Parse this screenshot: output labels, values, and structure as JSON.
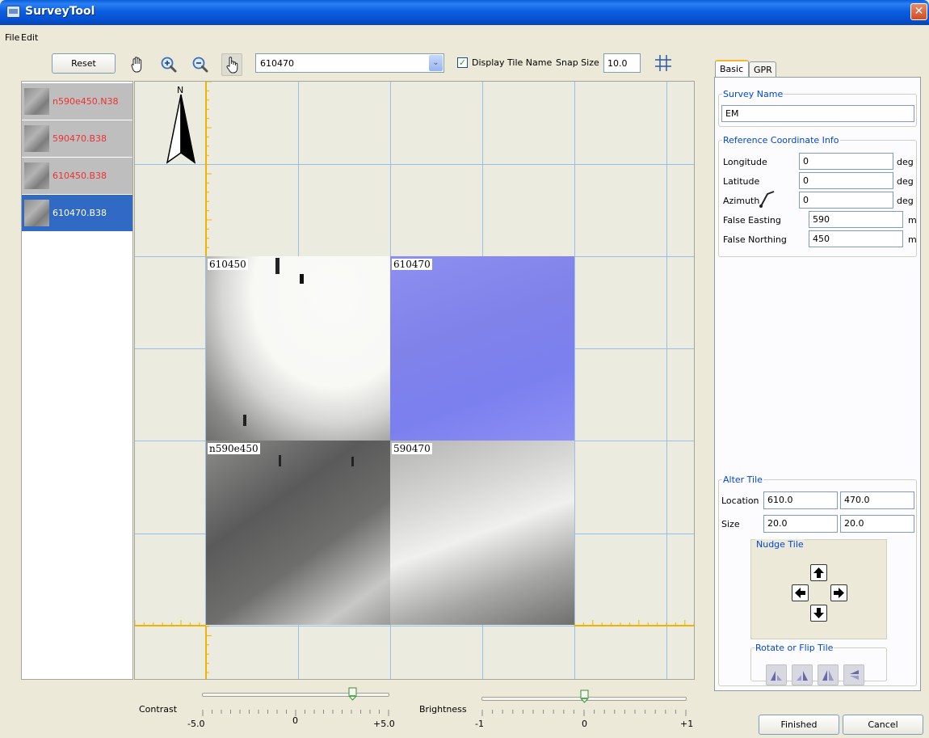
{
  "window": {
    "title": "SurveyTool",
    "close_label": "✕"
  },
  "menu": [
    "File",
    "Edit"
  ],
  "toolbar": {
    "reset_label": "Reset",
    "tile_select_value": "610470",
    "display_tile_name_checked": true,
    "display_tile_name_label": "Display Tile Name",
    "snap_size_label": "Snap Size",
    "snap_size_value": "10.0"
  },
  "files": [
    {
      "label": "n590e450.N38",
      "selected": false
    },
    {
      "label": "590470.B38",
      "selected": false
    },
    {
      "label": "610450.B38",
      "selected": false
    },
    {
      "label": "610470.B38",
      "selected": true
    }
  ],
  "canvas": {
    "north_label": "N",
    "tiles": [
      {
        "name": "610450",
        "highlighted": false
      },
      {
        "name": "610470",
        "highlighted": true
      },
      {
        "name": "n590e450",
        "highlighted": false
      },
      {
        "name": "590470",
        "highlighted": false
      }
    ]
  },
  "contrast": {
    "label": "Contrast",
    "min_label": "-5.0",
    "mid_label": "0",
    "max_label": "+5.0",
    "min": -5,
    "max": 5,
    "value": 3
  },
  "brightness": {
    "label": "Brightness",
    "min_label": "-1",
    "mid_label": "0",
    "max_label": "+1",
    "min": -1,
    "max": 1,
    "value": 0
  },
  "tabs": [
    "Basic",
    "GPR"
  ],
  "survey": {
    "group_title": "Survey Name",
    "name": "EM"
  },
  "reference": {
    "group_title": "Reference Coordinate Info",
    "longitude_label": "Longitude",
    "longitude_value": "0",
    "longitude_unit": "deg",
    "latitude_label": "Latitude",
    "latitude_value": "0",
    "latitude_unit": "deg",
    "azimuth_label": "Azimuth",
    "azimuth_value": "0",
    "azimuth_unit": "deg",
    "false_easting_label": "False Easting",
    "false_easting_value": "590",
    "false_easting_unit": "m",
    "false_northing_label": "False Northing",
    "false_northing_value": "450",
    "false_northing_unit": "m"
  },
  "alter": {
    "group_title": "Alter Tile",
    "location_label": "Location",
    "location_x": "610.0",
    "location_y": "470.0",
    "size_label": "Size",
    "size_x": "20.0",
    "size_y": "20.0",
    "nudge_title": "Nudge Tile",
    "rotate_title": "Rotate or Flip Tile"
  },
  "buttons": {
    "finished": "Finished",
    "cancel": "Cancel"
  }
}
